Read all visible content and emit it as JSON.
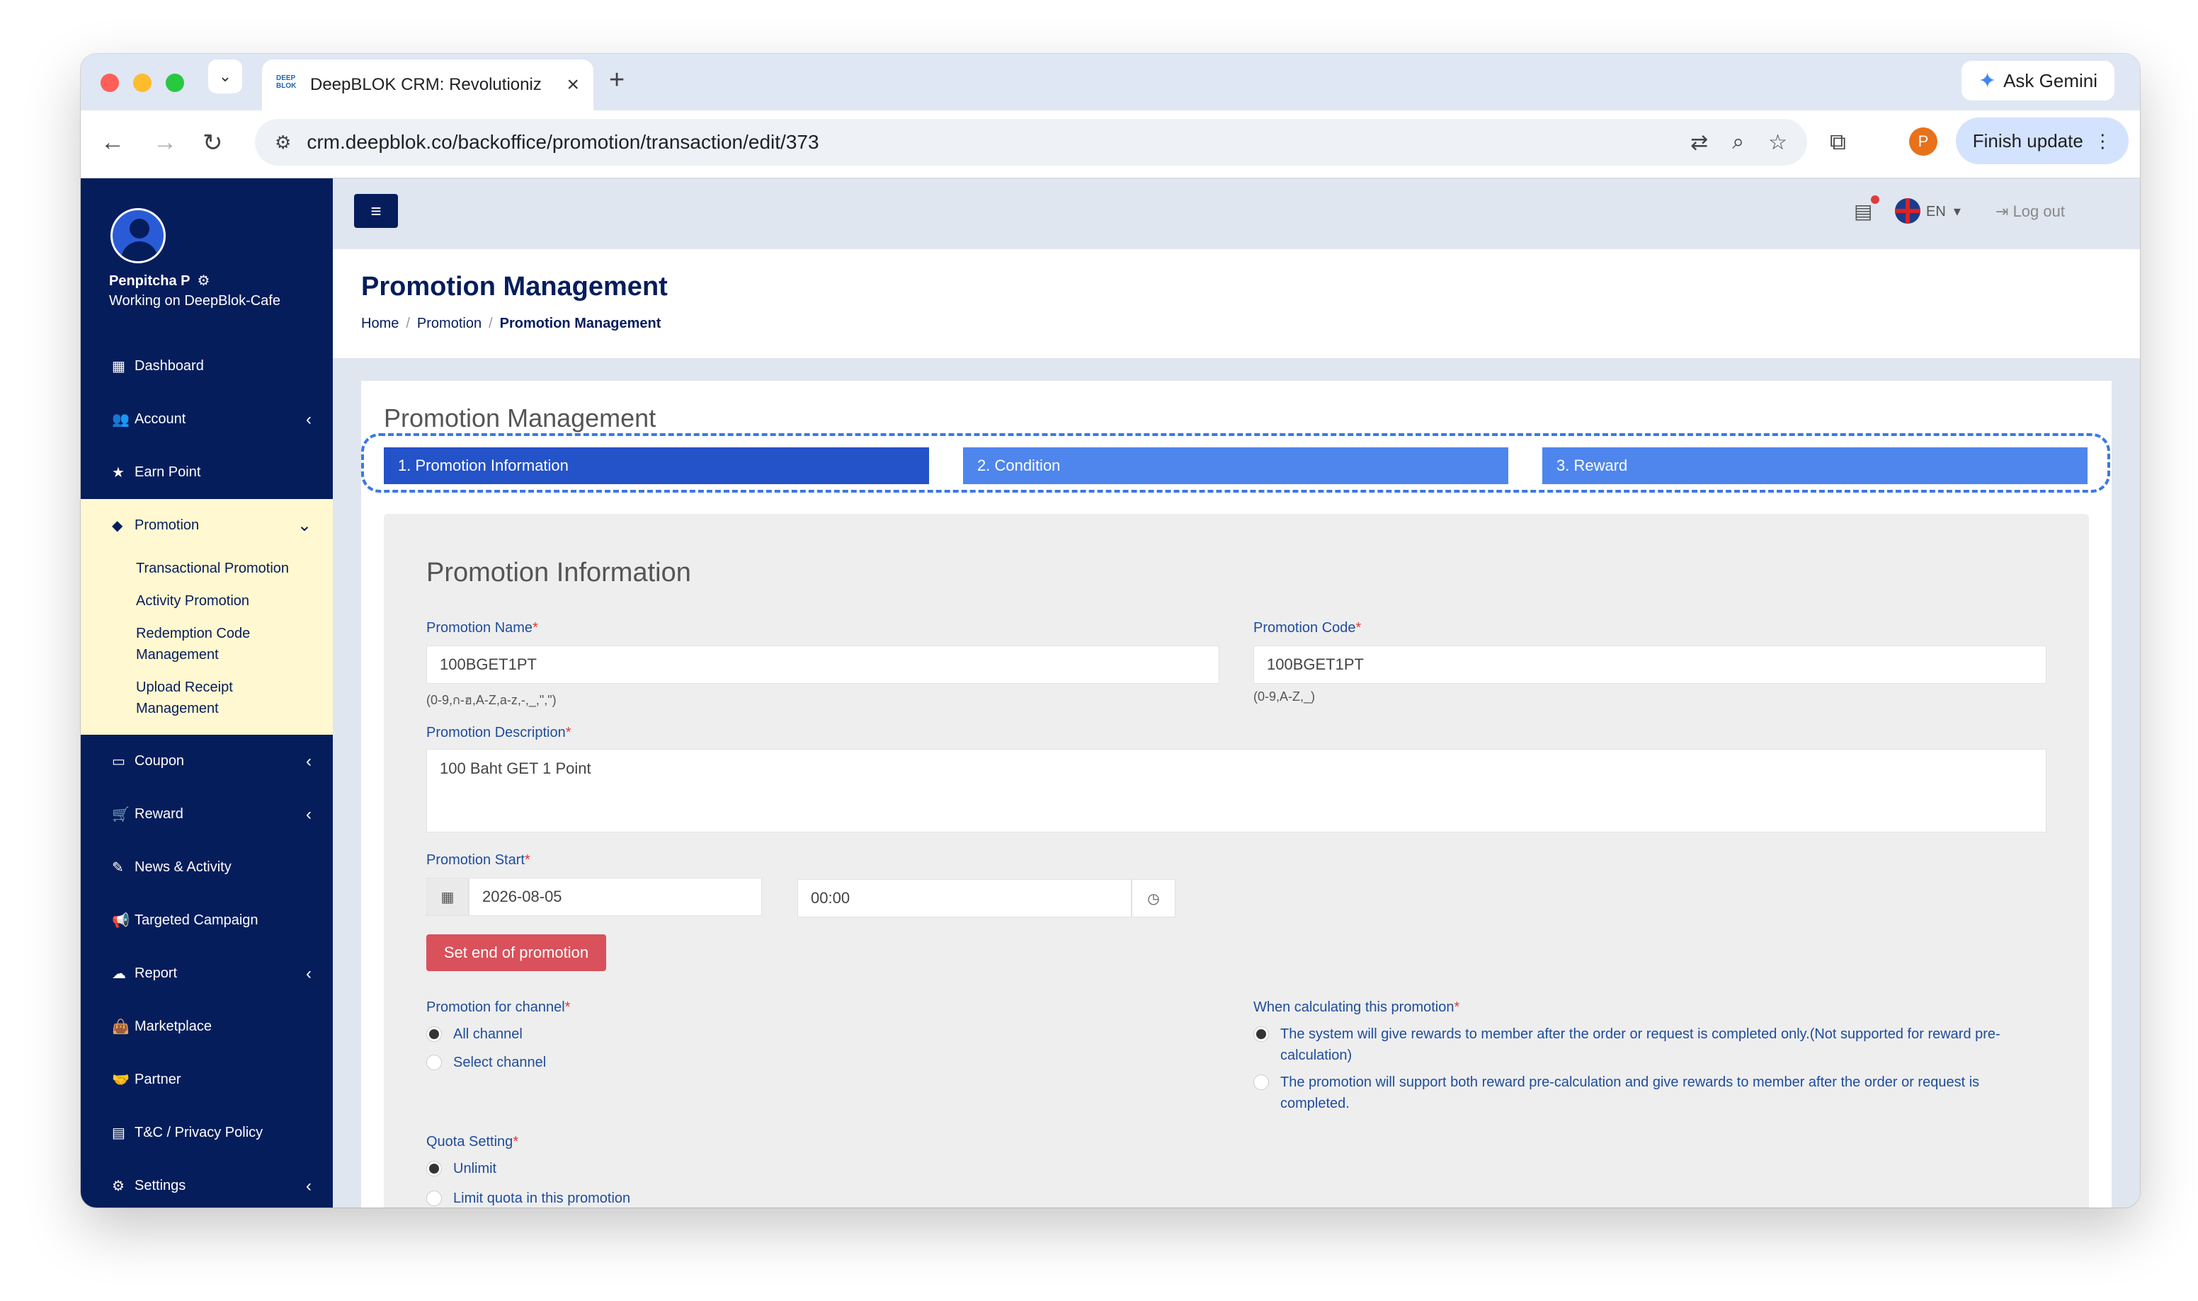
{
  "browser": {
    "tab_title": "DeepBLOK CRM: Revolutioniz",
    "tab_favicon": "DEEP BLOK",
    "url": "crm.deepblok.co/backoffice/promotion/transaction/edit/373",
    "ask_gemini": "Ask Gemini",
    "finish_update": "Finish update",
    "profile_initial": "P"
  },
  "user": {
    "name": "Penpitcha P",
    "workspace": "Working on DeepBlok-Cafe"
  },
  "sidebar": {
    "items": [
      {
        "label": "Dashboard",
        "icon": "dashboard-icon"
      },
      {
        "label": "Account",
        "icon": "users-icon"
      },
      {
        "label": "Earn Point",
        "icon": "star-icon"
      },
      {
        "label": "Promotion",
        "icon": "tag-icon"
      },
      {
        "label": "Coupon",
        "icon": "ticket-icon"
      },
      {
        "label": "Reward",
        "icon": "cart-icon"
      },
      {
        "label": "News & Activity",
        "icon": "edit-icon"
      },
      {
        "label": "Targeted Campaign",
        "icon": "megaphone-icon"
      },
      {
        "label": "Report",
        "icon": "cloud-icon"
      },
      {
        "label": "Marketplace",
        "icon": "bag-icon"
      },
      {
        "label": "Partner",
        "icon": "handshake-icon"
      },
      {
        "label": "T&C / Privacy Policy",
        "icon": "document-icon"
      },
      {
        "label": "Settings",
        "icon": "gear-icon"
      }
    ],
    "promotion_sub": [
      "Transactional Promotion",
      "Activity Promotion",
      "Redemption Code Management",
      "Upload Receipt Management"
    ]
  },
  "topnav": {
    "lang": "EN",
    "logout": "Log out"
  },
  "page": {
    "title": "Promotion Management",
    "breadcrumb": [
      "Home",
      "Promotion",
      "Promotion Management"
    ],
    "card_title": "Promotion Management"
  },
  "steps": [
    "1. Promotion Information",
    "2. Condition",
    "3. Reward"
  ],
  "form": {
    "section_title": "Promotion Information",
    "name_label": "Promotion Name",
    "name_value": "100BGET1PT",
    "name_hint": "(0-9,ก-ฮ,A-Z,a-z,-,_,\",\")",
    "code_label": "Promotion Code",
    "code_value": "100BGET1PT",
    "code_hint": "(0-9,A-Z,_)",
    "desc_label": "Promotion Description",
    "desc_value": "100 Baht GET 1 Point",
    "start_label": "Promotion Start",
    "start_date": "2026-08-05",
    "start_time": "00:00",
    "set_end_button": "Set end of promotion",
    "channel_label": "Promotion for channel",
    "channel_options": [
      "All channel",
      "Select channel"
    ],
    "calc_label": "When calculating this promotion",
    "calc_options": [
      "The system will give rewards to member after the order or request is completed only.(Not supported for reward pre-calculation)",
      "The promotion will support both reward pre-calculation and give rewards to member after the order or request is completed."
    ],
    "quota_label": "Quota Setting",
    "quota_options": [
      "Unlimit",
      "Limit quota in this promotion"
    ]
  }
}
